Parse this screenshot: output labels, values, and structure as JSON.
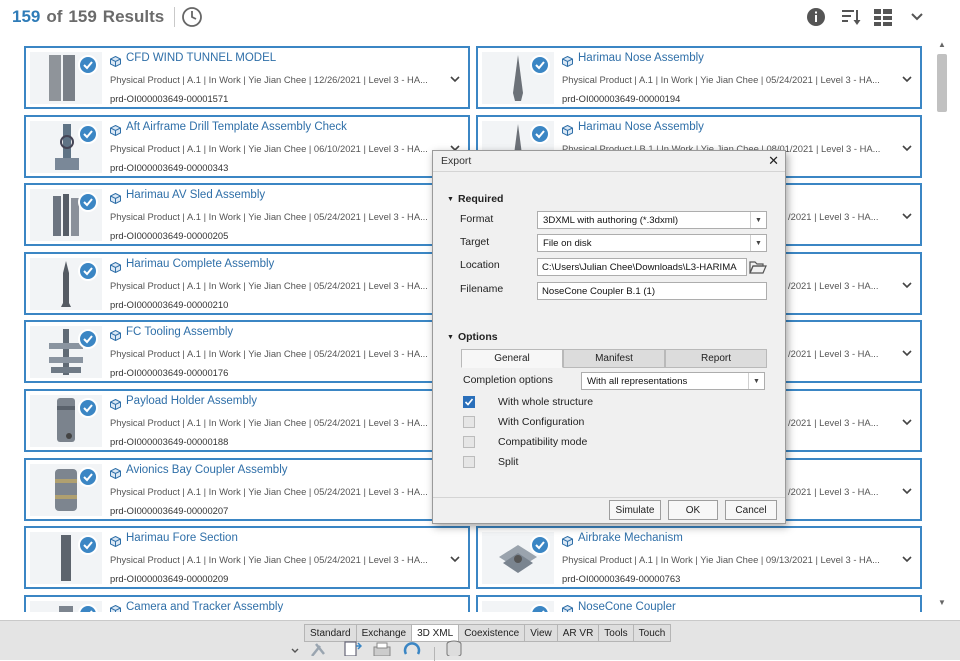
{
  "header": {
    "count": "159",
    "of_label": "of",
    "total": "159",
    "results_label": "Results"
  },
  "colors": {
    "accent": "#3b86c4",
    "count_blue": "#2f7cb8"
  },
  "cards": [
    {
      "title": "CFD WIND TUNNEL MODEL",
      "meta": "Physical Product | A.1 | In Work | Yie Jian Chee | 12/26/2021 | Level 3 - HA...",
      "id": "prd-OI000003649-00001571",
      "thumb": "wind-tunnel-model"
    },
    {
      "title": "Harimau Nose Assembly",
      "meta": "Physical Product | A.1 | In Work | Yie Jian Chee | 05/24/2021 | Level 3 - HA...",
      "id": "prd-OI000003649-00000194",
      "thumb": "nose-assembly"
    },
    {
      "title": "Aft Airframe Drill Template Assembly Check",
      "meta": "Physical Product | A.1 | In Work | Yie Jian Chee | 06/10/2021 | Level 3 - HA...",
      "id": "prd-OI000003649-00000343",
      "thumb": "drill-template"
    },
    {
      "title": "Harimau Nose Assembly",
      "meta": "Physical Product | B.1 | In Work | Yie Jian Chee | 08/01/2021 | Level 3 - HA...",
      "id": "",
      "thumb": "nose-assembly"
    },
    {
      "title": "Harimau AV Sled Assembly",
      "meta": "Physical Product | A.1 | In Work | Yie Jian Chee | 05/24/2021 | Level 3 - HA...",
      "id": "prd-OI000003649-00000205",
      "thumb": "sled"
    },
    {
      "title": "",
      "meta": "/2021 | Level 3 - HA...",
      "id": "",
      "thumb": ""
    },
    {
      "title": "Harimau Complete Assembly",
      "meta": "Physical Product | A.1 | In Work | Yie Jian Chee | 05/24/2021 | Level 3 - HA...",
      "id": "prd-OI000003649-00000210",
      "thumb": "complete"
    },
    {
      "title": "",
      "meta": "/2021 | Level 3 - HA...",
      "id": "",
      "thumb": ""
    },
    {
      "title": "FC Tooling Assembly",
      "meta": "Physical Product | A.1 | In Work | Yie Jian Chee | 05/24/2021 | Level 3 - HA...",
      "id": "prd-OI000003649-00000176",
      "thumb": "tooling"
    },
    {
      "title": "",
      "meta": "/2021 | Level 3 - HA...",
      "id": "",
      "thumb": ""
    },
    {
      "title": "Payload Holder Assembly",
      "meta": "Physical Product | A.1 | In Work | Yie Jian Chee | 05/24/2021 | Level 3 - HA...",
      "id": "prd-OI000003649-00000188",
      "thumb": "payload"
    },
    {
      "title": "",
      "meta": "/2021 | Level 3 - HA...",
      "id": "",
      "thumb": ""
    },
    {
      "title": "Avionics Bay Coupler Assembly",
      "meta": "Physical Product | A.1 | In Work | Yie Jian Chee | 05/24/2021 | Level 3 - HA...",
      "id": "prd-OI000003649-00000207",
      "thumb": "coupler"
    },
    {
      "title": "",
      "meta": "/2021 | Level 3 - HA...",
      "id": "",
      "thumb": ""
    },
    {
      "title": "Harimau Fore Section",
      "meta": "Physical Product | A.1 | In Work | Yie Jian Chee | 05/24/2021 | Level 3 - HA...",
      "id": "prd-OI000003649-00000209",
      "thumb": "fore"
    },
    {
      "title": "Airbrake Mechanism",
      "meta": "Physical Product | A.1 | In Work | Yie Jian Chee | 09/13/2021 | Level 3 - HA...",
      "id": "prd-OI000003649-00000763",
      "thumb": "airbrake"
    },
    {
      "title": "Camera and Tracker Assembly",
      "meta": "",
      "id": "",
      "thumb": "camera"
    },
    {
      "title": "NoseCone Coupler",
      "meta": "",
      "id": "",
      "thumb": "nosecone"
    }
  ],
  "dialog": {
    "title": "Export",
    "required_label": "Required",
    "format_label": "Format",
    "format_value": "3DXML with authoring (*.3dxml)",
    "target_label": "Target",
    "target_value": "File on disk",
    "location_label": "Location",
    "location_value": "C:\\Users\\Julian Chee\\Downloads\\L3-HARIMA",
    "filename_label": "Filename",
    "filename_value": "NoseCone Coupler B.1 (1)",
    "options_label": "Options",
    "tabs": [
      "General",
      "Manifest",
      "Report"
    ],
    "completion_label": "Completion options",
    "completion_value": "With all representations",
    "checkboxes": [
      {
        "label": "With whole structure",
        "checked": true
      },
      {
        "label": "With Configuration",
        "checked": false
      },
      {
        "label": "Compatibility mode",
        "checked": false
      },
      {
        "label": "Split",
        "checked": false
      }
    ],
    "simulate": "Simulate",
    "ok": "OK",
    "cancel": "Cancel"
  },
  "toolbar": {
    "tabs": [
      "Standard",
      "Exchange",
      "3D XML",
      "Coexistence",
      "View",
      "AR VR",
      "Tools",
      "Touch"
    ],
    "active_tab": "3D XML"
  }
}
